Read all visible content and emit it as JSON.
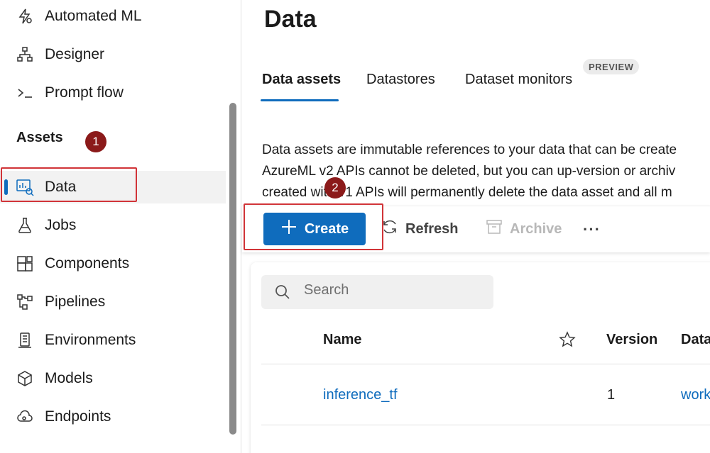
{
  "sidebar": {
    "items": [
      {
        "label": "Automated ML",
        "icon": "automated-ml-icon"
      },
      {
        "label": "Designer",
        "icon": "designer-icon"
      },
      {
        "label": "Prompt flow",
        "icon": "prompt-flow-icon"
      }
    ],
    "section_title": "Assets",
    "asset_items": [
      {
        "label": "Data",
        "icon": "data-icon",
        "active": true
      },
      {
        "label": "Jobs",
        "icon": "jobs-icon"
      },
      {
        "label": "Components",
        "icon": "components-icon"
      },
      {
        "label": "Pipelines",
        "icon": "pipelines-icon"
      },
      {
        "label": "Environments",
        "icon": "environments-icon"
      },
      {
        "label": "Models",
        "icon": "models-icon"
      },
      {
        "label": "Endpoints",
        "icon": "endpoints-icon"
      }
    ]
  },
  "callouts": {
    "step1": "1",
    "step2": "2"
  },
  "main": {
    "title": "Data",
    "tabs": [
      {
        "label": "Data assets",
        "active": true
      },
      {
        "label": "Datastores"
      },
      {
        "label": "Dataset monitors",
        "pill": "PREVIEW"
      }
    ],
    "description": [
      "Data assets are immutable references to your data that can be create",
      "AzureML v2 APIs cannot be deleted, but you can up-version or archiv",
      "created with v1 APIs will permanently delete the data asset and all m"
    ],
    "toolbar": {
      "create": "Create",
      "refresh": "Refresh",
      "archive": "Archive",
      "more": "···"
    },
    "search": {
      "placeholder": "Search"
    },
    "table": {
      "columns": [
        "Name",
        "Version",
        "Data"
      ],
      "rows": [
        {
          "name": "inference_tf",
          "version": "1",
          "data": "work"
        }
      ]
    }
  },
  "colors": {
    "accent": "#0f6cbd",
    "callout_border": "#d13438",
    "badge": "#8b1a1a"
  }
}
